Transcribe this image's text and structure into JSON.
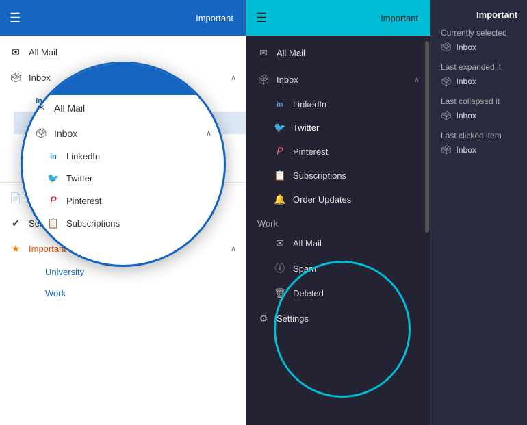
{
  "left": {
    "header": {
      "label": "Important"
    },
    "nav": {
      "all_mail": "All Mail",
      "inbox": "Inbox",
      "inbox_items": [
        "LinkedIn",
        "Twitter",
        "Pinterest",
        "Subscriptions"
      ],
      "drafts": "Drafts",
      "sent": "Sent",
      "important": "Important",
      "important_items": [
        "University",
        "Work"
      ]
    }
  },
  "zoom_popup": {
    "items": [
      "All Mail",
      "Inbox"
    ],
    "inbox_sub": [
      "LinkedIn",
      "Twitter",
      "Pinterest",
      "Subscriptions"
    ]
  },
  "right": {
    "header": {
      "label": "Important"
    },
    "nav": {
      "all_mail": "All Mail",
      "inbox": "Inbox",
      "inbox_items": [
        "LinkedIn",
        "Twitter",
        "Pinterest",
        "Subscriptions",
        "Order Updates"
      ],
      "work": "Work",
      "work_items": [
        "All Mail",
        "Spam",
        "Deleted"
      ],
      "settings": "Settings"
    },
    "info": {
      "title": "Important",
      "currently_selected_label": "Currently selected",
      "currently_selected_value": "Inbox",
      "last_expanded_label": "Last expanded it",
      "last_expanded_value": "Inbox",
      "last_collapsed_label": "Last collapsed it",
      "last_collapsed_value": "Inbox",
      "last_clicked_label": "Last clicked item",
      "last_clicked_value": "Inbox"
    }
  },
  "icons": {
    "hamburger": "☰",
    "mail": "✉",
    "inbox": "🗳",
    "linkedin": "in",
    "twitter": "🐦",
    "pinterest": "𝑃",
    "subscriptions": "📋",
    "order_updates": "🔔",
    "drafts": "📄",
    "sent": "✔",
    "important": "★",
    "spam": "ⓘ",
    "deleted": "🗑",
    "settings": "⚙"
  }
}
